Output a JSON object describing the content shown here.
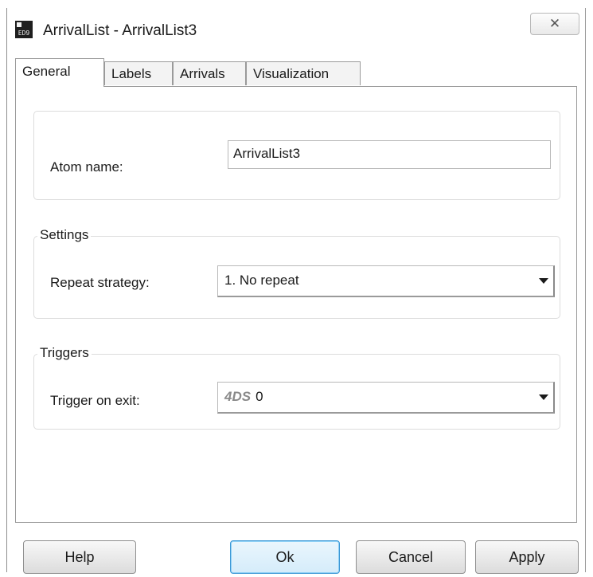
{
  "window": {
    "title": "ArrivalList - ArrivalList3",
    "app_icon_label": "ED9",
    "close_symbol": "✕"
  },
  "tabs": [
    {
      "label": "General",
      "active": true
    },
    {
      "label": "Labels",
      "active": false
    },
    {
      "label": "Arrivals",
      "active": false
    },
    {
      "label": "Visualization",
      "active": false
    }
  ],
  "general": {
    "atom_name_label": "Atom name:",
    "atom_name_value": "ArrivalList3",
    "settings": {
      "legend": "Settings",
      "repeat_strategy_label": "Repeat strategy:",
      "repeat_strategy_value": "1. No repeat"
    },
    "triggers": {
      "legend": "Triggers",
      "trigger_on_exit_label": "Trigger on exit:",
      "trigger_on_exit_prefix": "4DS",
      "trigger_on_exit_value": "0"
    }
  },
  "buttons": {
    "help": "Help",
    "ok": "Ok",
    "cancel": "Cancel",
    "apply": "Apply"
  },
  "icons": {
    "app": "app-icon",
    "close": "close-icon",
    "dropdown": "chevron-down-icon"
  },
  "colors": {
    "default_button_border": "#3c98d6",
    "panel_border": "#9a9a9a"
  }
}
